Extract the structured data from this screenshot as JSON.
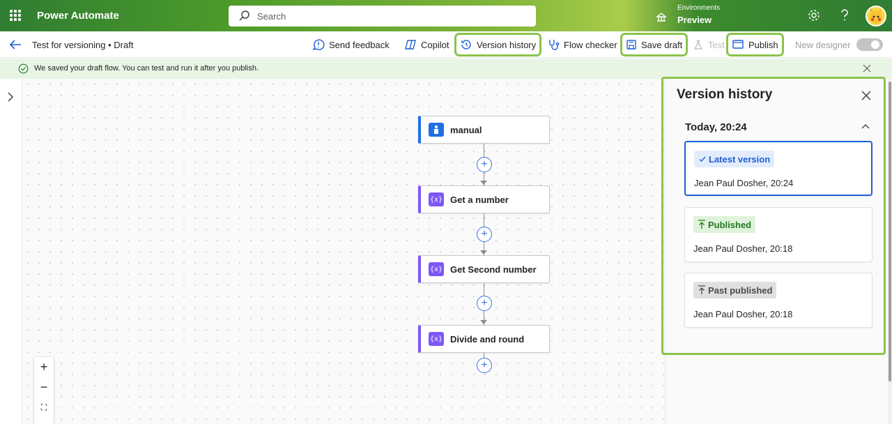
{
  "header": {
    "brand": "Power Automate",
    "search_placeholder": "Search",
    "environment_label": "Environments",
    "environment_value": "Preview"
  },
  "cmdbar": {
    "breadcrumb": "Test for versioning • Draft",
    "send_feedback": "Send feedback",
    "copilot": "Copilot",
    "version_history": "Version history",
    "flow_checker": "Flow checker",
    "save_draft": "Save draft",
    "test": "Test",
    "publish": "Publish",
    "new_designer": "New designer",
    "new_designer_on": false
  },
  "banner": {
    "message": "We saved your draft flow. You can test and run it after you publish."
  },
  "flow": {
    "nodes": [
      {
        "label": "manual",
        "kind": "trigger"
      },
      {
        "label": "Get a number",
        "kind": "variable"
      },
      {
        "label": "Get Second number",
        "kind": "variable"
      },
      {
        "label": "Divide and round",
        "kind": "variable"
      }
    ],
    "add_symbol": "+"
  },
  "zoom": {
    "zoom_in": "+",
    "zoom_out": "−",
    "fit": "⛶"
  },
  "version_panel": {
    "title": "Version history",
    "date_group": "Today, 20:24",
    "versions": [
      {
        "badge": "Latest version",
        "meta": "Jean Paul Dosher, 20:24"
      },
      {
        "badge": "Published",
        "meta": "Jean Paul Dosher, 20:18"
      },
      {
        "badge": "Past published",
        "meta": "Jean Paul Dosher, 20:18"
      }
    ]
  },
  "colors": {
    "accent_blue": "#1f5fd6",
    "highlight_green": "#8bc34a",
    "variable_purple": "#7e57f7",
    "trigger_blue": "#1f6fe5"
  }
}
